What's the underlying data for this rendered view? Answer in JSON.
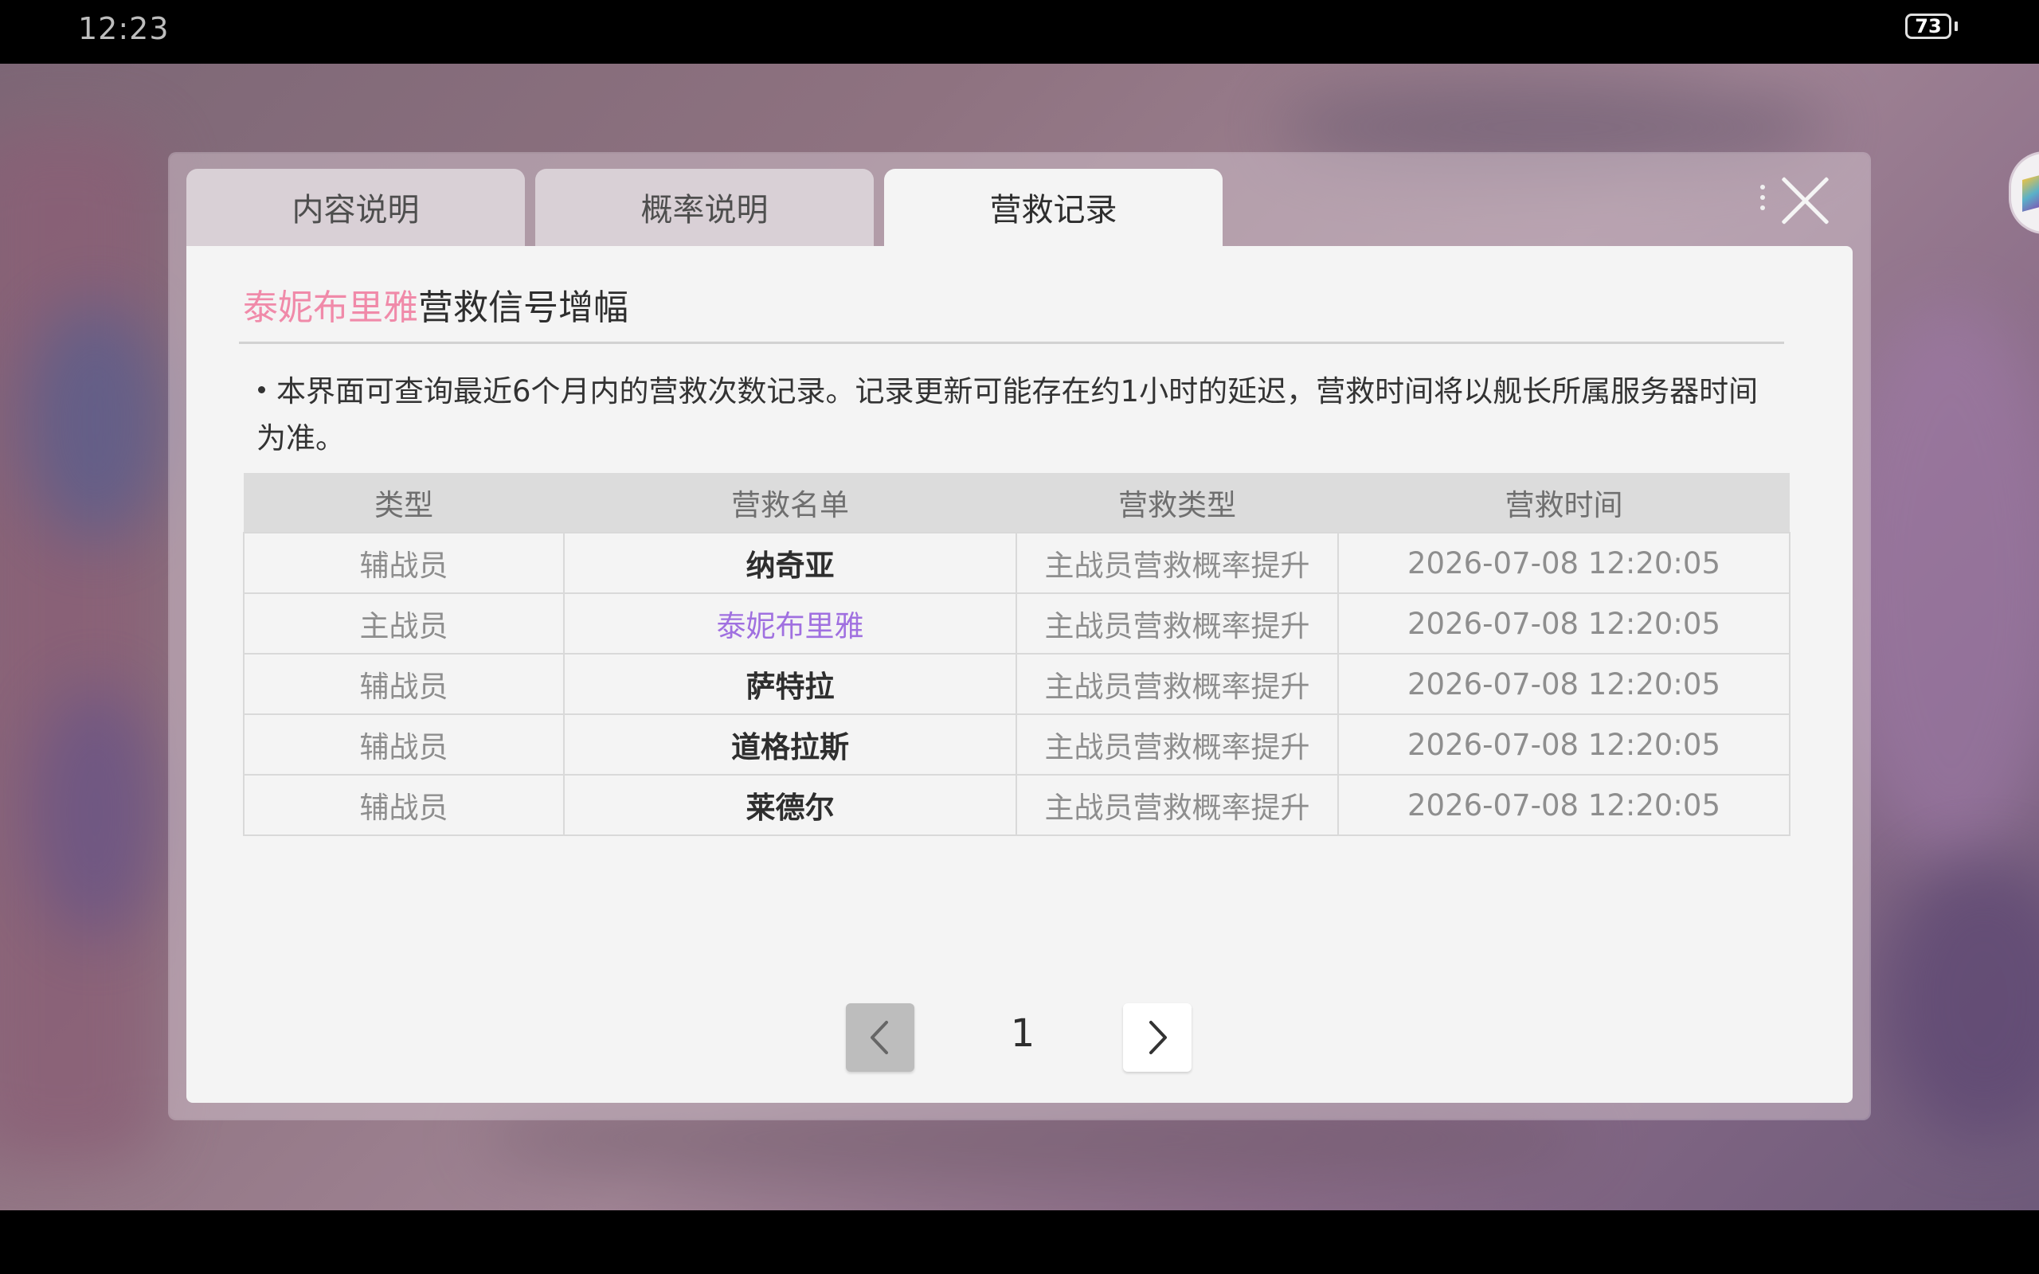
{
  "status_bar": {
    "time": "12:23",
    "battery": "73"
  },
  "tabs": [
    {
      "label": "内容说明",
      "active": false
    },
    {
      "label": "概率说明",
      "active": false
    },
    {
      "label": "营救记录",
      "active": true
    }
  ],
  "panel": {
    "title_highlight": "泰妮布里雅",
    "title_rest": "营救信号增幅",
    "notice": "本界面可查询最近6个月内的营救次数记录。记录更新可能存在约1小时的延迟，营救时间将以舰长所属服务器时间为准。"
  },
  "table": {
    "headers": [
      "类型",
      "营救名单",
      "营救类型",
      "营救时间"
    ],
    "rows": [
      {
        "type": "辅战员",
        "name": "纳奇亚",
        "rescue_type": "主战员营救概率提升",
        "time": "2026-07-08 12:20:05",
        "highlight": false
      },
      {
        "type": "主战员",
        "name": "泰妮布里雅",
        "rescue_type": "主战员营救概率提升",
        "time": "2026-07-08 12:20:05",
        "highlight": true
      },
      {
        "type": "辅战员",
        "name": "萨特拉",
        "rescue_type": "主战员营救概率提升",
        "time": "2026-07-08 12:20:05",
        "highlight": false
      },
      {
        "type": "辅战员",
        "name": "道格拉斯",
        "rescue_type": "主战员营救概率提升",
        "time": "2026-07-08 12:20:05",
        "highlight": false
      },
      {
        "type": "辅战员",
        "name": "莱德尔",
        "rescue_type": "主战员营救概率提升",
        "time": "2026-07-08 12:20:05",
        "highlight": false
      }
    ]
  },
  "pagination": {
    "current_page": "1"
  },
  "colors": {
    "highlight_pink": "#f08aa9",
    "highlight_purple": "#a070e0",
    "panel_bg": "#f4f4f4",
    "header_bg": "#dcdcdc"
  },
  "icons": {
    "close": "close-icon",
    "more": "more-icon",
    "prev": "chevron-left-icon",
    "next": "chevron-right-icon"
  }
}
